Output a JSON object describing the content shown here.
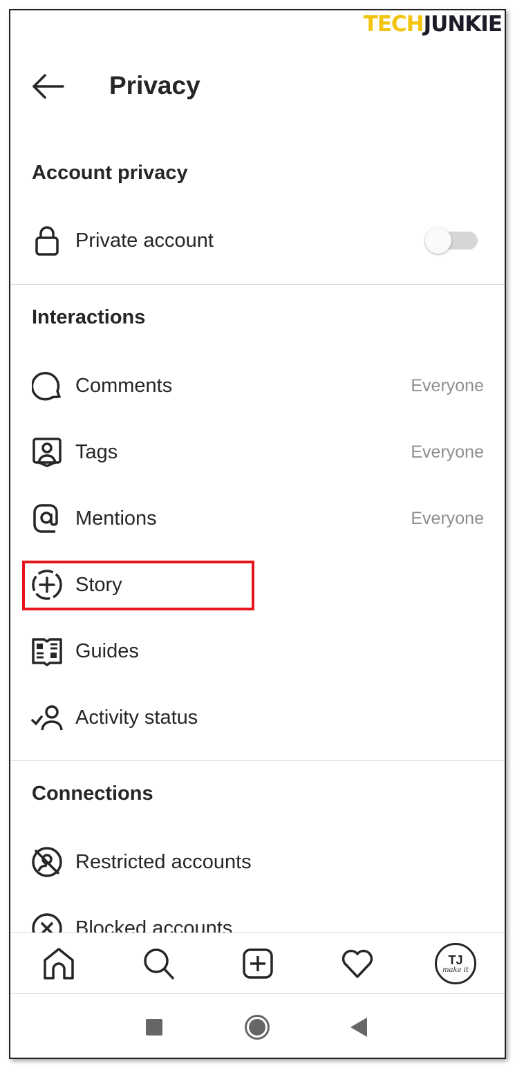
{
  "watermark": {
    "part1": "TECH",
    "part2": "JUNKIE"
  },
  "header": {
    "title": "Privacy"
  },
  "sections": {
    "account_privacy": {
      "title": "Account privacy",
      "private_account": {
        "label": "Private account",
        "enabled": false
      }
    },
    "interactions": {
      "title": "Interactions",
      "items": [
        {
          "label": "Comments",
          "value": "Everyone",
          "icon": "comment-icon"
        },
        {
          "label": "Tags",
          "value": "Everyone",
          "icon": "tag-person-icon"
        },
        {
          "label": "Mentions",
          "value": "Everyone",
          "icon": "at-icon"
        },
        {
          "label": "Story",
          "icon": "story-add-icon",
          "highlighted": true
        },
        {
          "label": "Guides",
          "icon": "guides-icon"
        },
        {
          "label": "Activity status",
          "icon": "activity-status-icon"
        }
      ]
    },
    "connections": {
      "title": "Connections",
      "items": [
        {
          "label": "Restricted accounts",
          "icon": "restricted-icon"
        },
        {
          "label": "Blocked accounts",
          "icon": "blocked-icon"
        }
      ]
    }
  },
  "bottom_nav": {
    "items": [
      "home-icon",
      "search-icon",
      "new-post-icon",
      "activity-heart-icon",
      "profile-avatar"
    ],
    "avatar_text": "TJ",
    "avatar_subtext": "make it"
  },
  "colors": {
    "highlight": "#e8141b",
    "logo_yellow": "#f2c40f"
  }
}
